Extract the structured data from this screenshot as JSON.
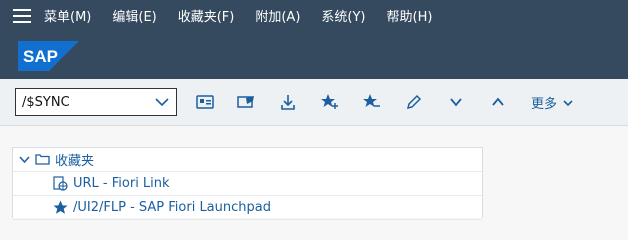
{
  "menubar": {
    "items": [
      "菜单(M)",
      "编辑(E)",
      "收藏夹(F)",
      "附加(A)",
      "系统(Y)",
      "帮助(H)"
    ]
  },
  "logo": {
    "text": "SAP"
  },
  "toolbar": {
    "tcode_value": "/$SYNC",
    "more_label": "更多"
  },
  "tree": {
    "root_label": "收藏夹",
    "items": [
      {
        "label": "URL - Fiori Link",
        "icon": "url-link-icon"
      },
      {
        "label": "/UI2/FLP - SAP Fiori Launchpad",
        "icon": "star-icon"
      }
    ]
  },
  "colors": {
    "shell": "#354a5f",
    "toolbar": "#eef1f3",
    "accent": "#1b5fa0",
    "logo_blue": "#1170cf"
  }
}
